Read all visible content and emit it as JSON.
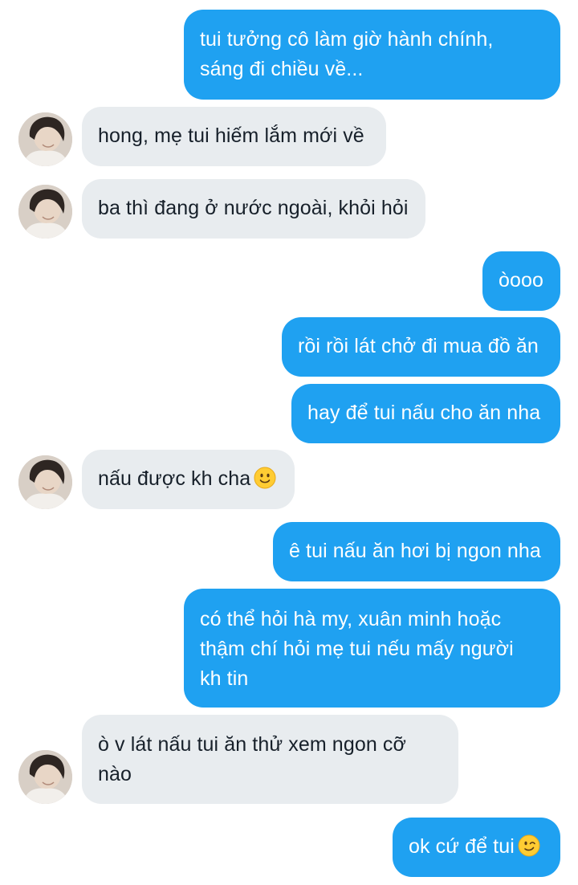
{
  "conversation": {
    "messages": [
      {
        "direction": "outgoing",
        "lines": [
          "tui tưởng cô làm giờ hành chính,",
          "sáng đi chiều về..."
        ]
      },
      {
        "direction": "incoming",
        "lines": [
          "hong, mẹ tui hiếm lắm mới về"
        ]
      },
      {
        "direction": "incoming",
        "lines": [
          "ba thì đang ở nước ngoài, khỏi hỏi"
        ]
      },
      {
        "direction": "outgoing",
        "lines": [
          "òooo"
        ]
      },
      {
        "direction": "outgoing",
        "lines": [
          "rồi rồi lát chở đi mua đồ ăn"
        ]
      },
      {
        "direction": "outgoing",
        "lines": [
          "hay để tui nấu cho ăn nha"
        ]
      },
      {
        "direction": "incoming",
        "lines": [
          "nấu được kh cha"
        ],
        "emoji": "slightly-smiling-face"
      },
      {
        "direction": "outgoing",
        "lines": [
          "ê tui nấu ăn hơi bị ngon nha"
        ]
      },
      {
        "direction": "outgoing",
        "lines": [
          "có thể hỏi hà my, xuân minh hoặc",
          "thậm chí hỏi mẹ tui nếu mấy người",
          "kh tin"
        ]
      },
      {
        "direction": "incoming",
        "lines": [
          "ò v lát nấu tui ăn thử xem ngon cỡ",
          "nào"
        ]
      },
      {
        "direction": "outgoing",
        "lines": [
          "ok cứ để tui"
        ],
        "emoji": "winking-face"
      }
    ]
  },
  "theme": {
    "outgoing_bubble_color": "#1fa1f1",
    "incoming_bubble_color": "#e8ecef",
    "outgoing_text_color": "#ffffff",
    "incoming_text_color": "#17202a"
  },
  "icons": {
    "contact_avatar": "contact-avatar",
    "smile_emoji": "slightly-smiling-face-emoji",
    "wink_emoji": "winking-face-emoji"
  }
}
